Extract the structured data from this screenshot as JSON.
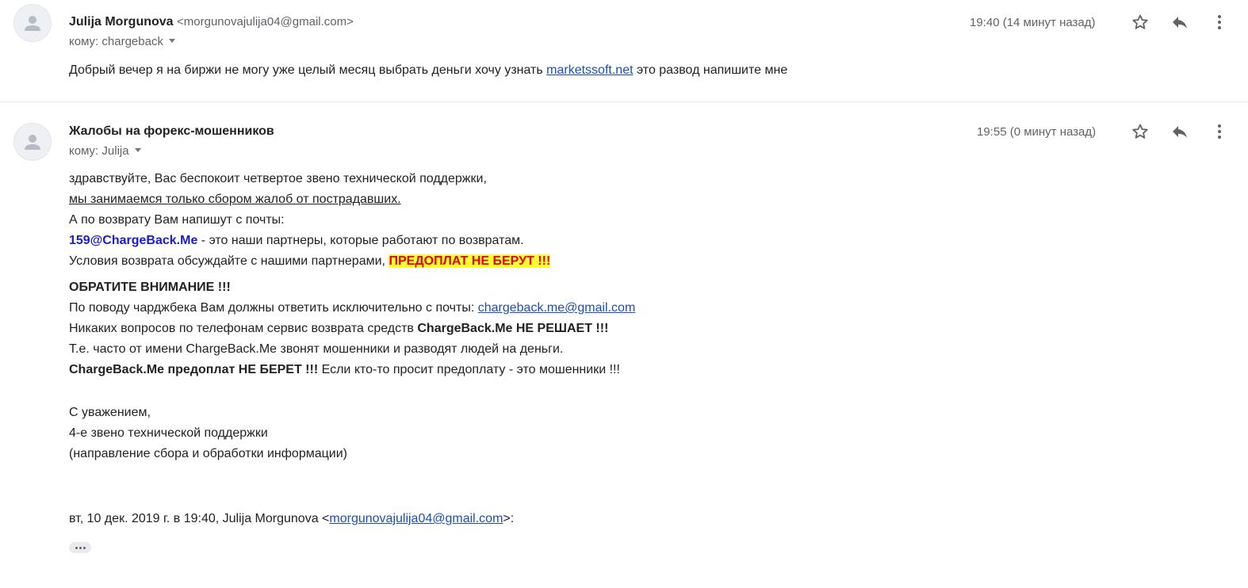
{
  "message1": {
    "sender_name": "Julija Morgunova",
    "sender_email": "<morgunovajulija04@gmail.com>",
    "to_label": "кому: chargeback",
    "time": "19:40 (14 минут назад)",
    "body_prefix": "Добрый вечер я на биржи не могу уже целый месяц выбрать деньги хочу узнать ",
    "body_link": "marketssoft.net",
    "body_suffix": " это развод напишите мне"
  },
  "message2": {
    "sender_name": "Жалобы на форекс-мошенников",
    "to_label": "кому: Julija",
    "time": "19:55 (0 минут назад)",
    "line1": "здравствуйте, Вас беспокоит четвертое звено технической поддержки,",
    "line2": "мы занимаемся только сбором жалоб от пострадавших.",
    "line3": "А по возврату Вам напишут с почты:",
    "line4_email": "159@ChargeBack.Me",
    "line4_rest": " - это наши партнеры, которые работают по возвратам.",
    "line5_text": "Условия возврата обсуждайте с нашими партнерами, ",
    "line5_highlight": "ПРЕДОПЛАТ НЕ БЕРУТ !!!",
    "line6": "ОБРАТИТЕ ВНИМАНИЕ !!!",
    "line7_text": "По поводу чарджбека Вам должны ответить исключительно с почты: ",
    "line7_link": "chargeback.me@gmail.com",
    "line8_text": "Никаких вопросов по телефонам сервис возврата средств ",
    "line8_bold": "ChargeBack.Me НЕ РЕШАЕТ !!!",
    "line9": "Т.е. часто от имени ChargeBack.Me звонят мошенники и разводят людей на деньги.",
    "line10_bold": "ChargeBack.Me предоплат НЕ БЕРЕТ !!!",
    "line10_rest": " Если кто-то просит предоплату - это мошенники !!!",
    "sig1": "С уважением,",
    "sig2": "4-е звено технической поддержки",
    "sig3": "(направление сбора и обработки информации)",
    "quote_prefix": "вт, 10 дек. 2019 г. в 19:40, Julija Morgunova <",
    "quote_link": "morgunovajulija04@gmail.com",
    "quote_suffix": ">:"
  },
  "icons": {
    "star": "star-icon",
    "reply": "reply-icon",
    "more": "more-vert-icon",
    "avatar": "person-avatar-icon",
    "expand": "show-trimmed-content-icon"
  },
  "colors": {
    "link": "#1a4fb8",
    "email_highlight_blue": "#1a1ad6",
    "highlight_bg": "#ffff33",
    "highlight_text": "#e60000",
    "muted": "#5f6368"
  }
}
